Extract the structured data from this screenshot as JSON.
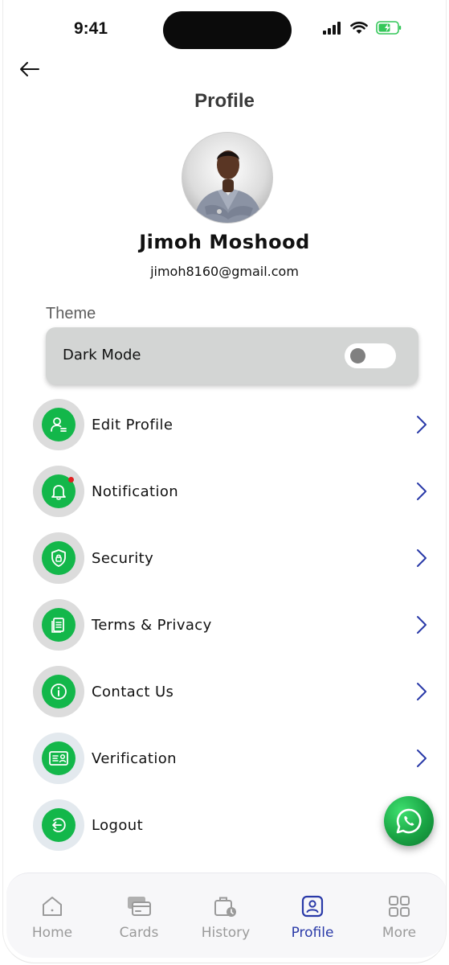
{
  "status_bar": {
    "time": "9:41"
  },
  "header": {
    "title": "Profile"
  },
  "user": {
    "name": "Jimoh Moshood",
    "email": "jimoh8160@gmail.com"
  },
  "theme": {
    "section_label": "Theme",
    "dark_mode_label": "Dark Mode",
    "dark_mode_enabled": false
  },
  "menu": {
    "items": [
      {
        "label": "Edit Profile",
        "icon": "user-edit-icon"
      },
      {
        "label": "Notification",
        "icon": "bell-icon"
      },
      {
        "label": "Security",
        "icon": "shield-lock-icon"
      },
      {
        "label": "Terms & Privacy",
        "icon": "document-icon"
      },
      {
        "label": "Contact Us",
        "icon": "info-icon"
      },
      {
        "label": "Verification",
        "icon": "id-card-icon"
      },
      {
        "label": "Logout",
        "icon": "logout-icon"
      }
    ]
  },
  "bottom_nav": {
    "active": "Profile",
    "items": [
      {
        "label": "Home",
        "icon": "home-icon"
      },
      {
        "label": "Cards",
        "icon": "cards-icon"
      },
      {
        "label": "History",
        "icon": "history-icon"
      },
      {
        "label": "Profile",
        "icon": "profile-icon"
      },
      {
        "label": "More",
        "icon": "grid-icon"
      }
    ]
  },
  "colors": {
    "accent_green": "#13B74A",
    "nav_active": "#2A3AA8",
    "chevron": "#2A3AA8",
    "notification_dot": "#E02020"
  }
}
